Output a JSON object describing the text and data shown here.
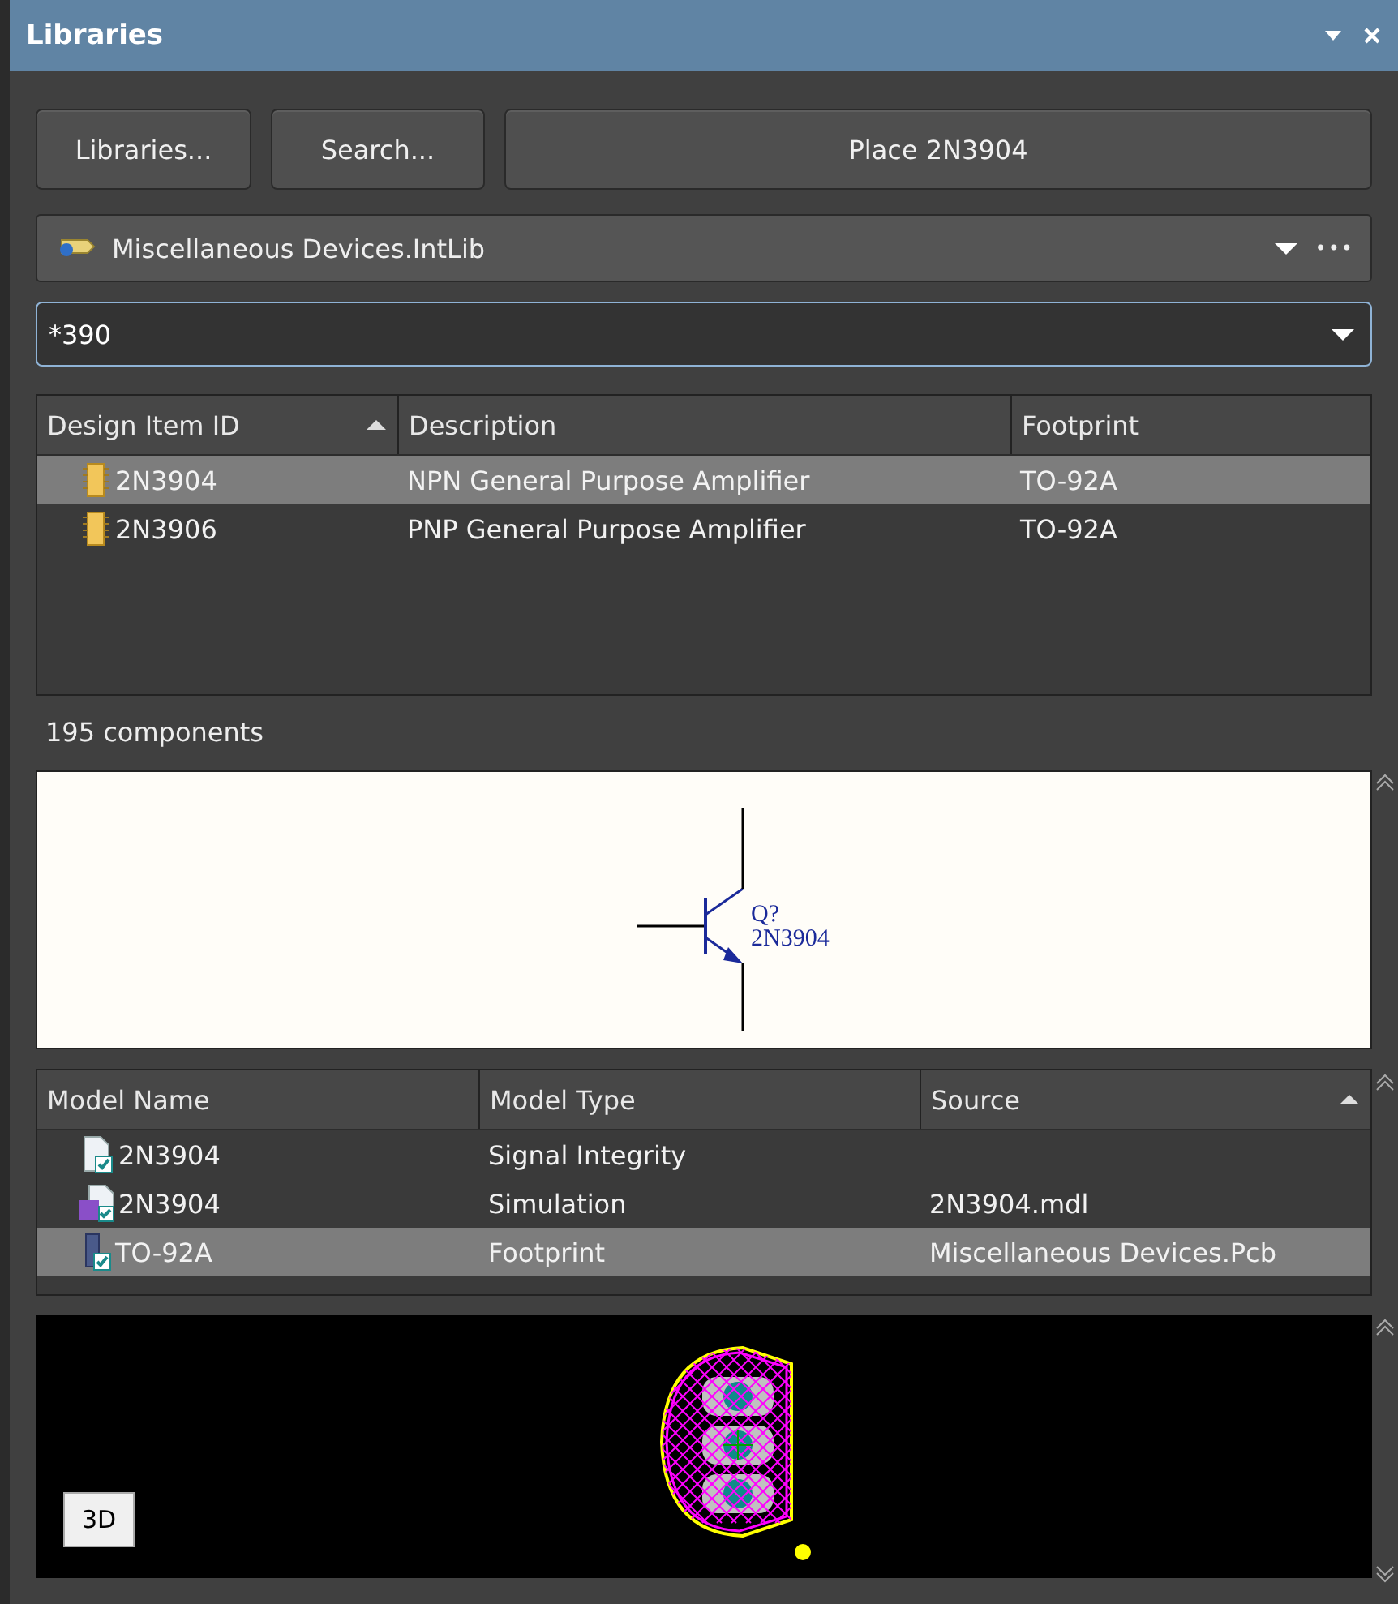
{
  "window": {
    "title": "Libraries"
  },
  "buttons": [
    {
      "label": "Libraries..."
    },
    {
      "label": "Search..."
    },
    {
      "label": "Place 2N3904"
    }
  ],
  "library": {
    "value": "Miscellaneous Devices.IntLib",
    "more": "•••"
  },
  "filter": {
    "value": "*390"
  },
  "components": {
    "columns": [
      {
        "label": "Design Item ID",
        "sorted": true
      },
      {
        "label": "Description",
        "sorted": false
      },
      {
        "label": "Footprint",
        "sorted": false
      }
    ],
    "rows": [
      {
        "cells": [
          "2N3904",
          "NPN General Purpose Amplifier",
          "TO-92A"
        ],
        "selected": true,
        "kind": "chip"
      },
      {
        "cells": [
          "2N3906",
          "PNP General Purpose Amplifier",
          "TO-92A"
        ],
        "selected": false,
        "kind": "chip"
      }
    ]
  },
  "count": "195 components",
  "schematic": {
    "designator": "Q?",
    "comment": "2N3904"
  },
  "models": {
    "columns": [
      {
        "label": "Model Name",
        "sorted": false
      },
      {
        "label": "Model Type",
        "sorted": false
      },
      {
        "label": "Source",
        "sorted": true
      }
    ],
    "rows": [
      {
        "cells": [
          "2N3904",
          "Signal Integrity",
          ""
        ],
        "selected": false,
        "kind": "signal-integrity"
      },
      {
        "cells": [
          "2N3904",
          "Simulation",
          "2N3904.mdl"
        ],
        "selected": false,
        "kind": "simulation"
      },
      {
        "cells": [
          "TO-92A",
          "Footprint",
          "Miscellaneous Devices.Pcb"
        ],
        "selected": true,
        "kind": "footprint"
      }
    ]
  },
  "footprint": {
    "view_button": "3D"
  }
}
